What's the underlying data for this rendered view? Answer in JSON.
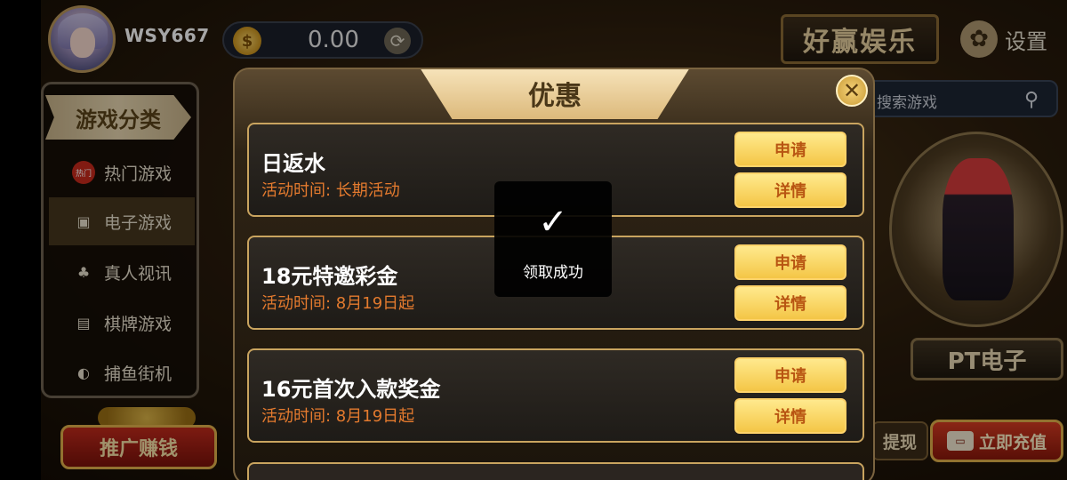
{
  "user": {
    "username": "WSY667",
    "balance": "0.00"
  },
  "brand": {
    "name": "好赢娱乐"
  },
  "settings": {
    "label": "设置"
  },
  "sidebar": {
    "header": "游戏分类",
    "items": [
      {
        "label": "热门游戏",
        "icon": "hot-badge-icon",
        "badge": "热门"
      },
      {
        "label": "电子游戏",
        "icon": "slot-machine-icon",
        "active": true
      },
      {
        "label": "真人视讯",
        "icon": "dealer-icon"
      },
      {
        "label": "棋牌游戏",
        "icon": "cards-icon"
      },
      {
        "label": "捕鱼街机",
        "icon": "fish-icon"
      }
    ]
  },
  "search": {
    "placeholder": "搜索游戏"
  },
  "featured": {
    "label": "PT电子"
  },
  "bottom": {
    "promo": "推广赚钱",
    "withdraw": "提现",
    "recharge": "立即充值"
  },
  "modal": {
    "title": "优惠",
    "offers": [
      {
        "title": "日返水",
        "time": "活动时间: 长期活动",
        "apply": "申请",
        "detail": "详情"
      },
      {
        "title": "18元特邀彩金",
        "time": "活动时间: 8月19日起",
        "apply": "申请",
        "detail": "详情"
      },
      {
        "title": "16元首次入款奖金",
        "time": "活动时间: 8月19日起",
        "apply": "申请",
        "detail": "详情"
      }
    ]
  },
  "toast": {
    "message": "领取成功"
  },
  "colors": {
    "accent_gold": "#f4c646",
    "time_orange": "#e37a2e",
    "button_text": "#b85512"
  }
}
